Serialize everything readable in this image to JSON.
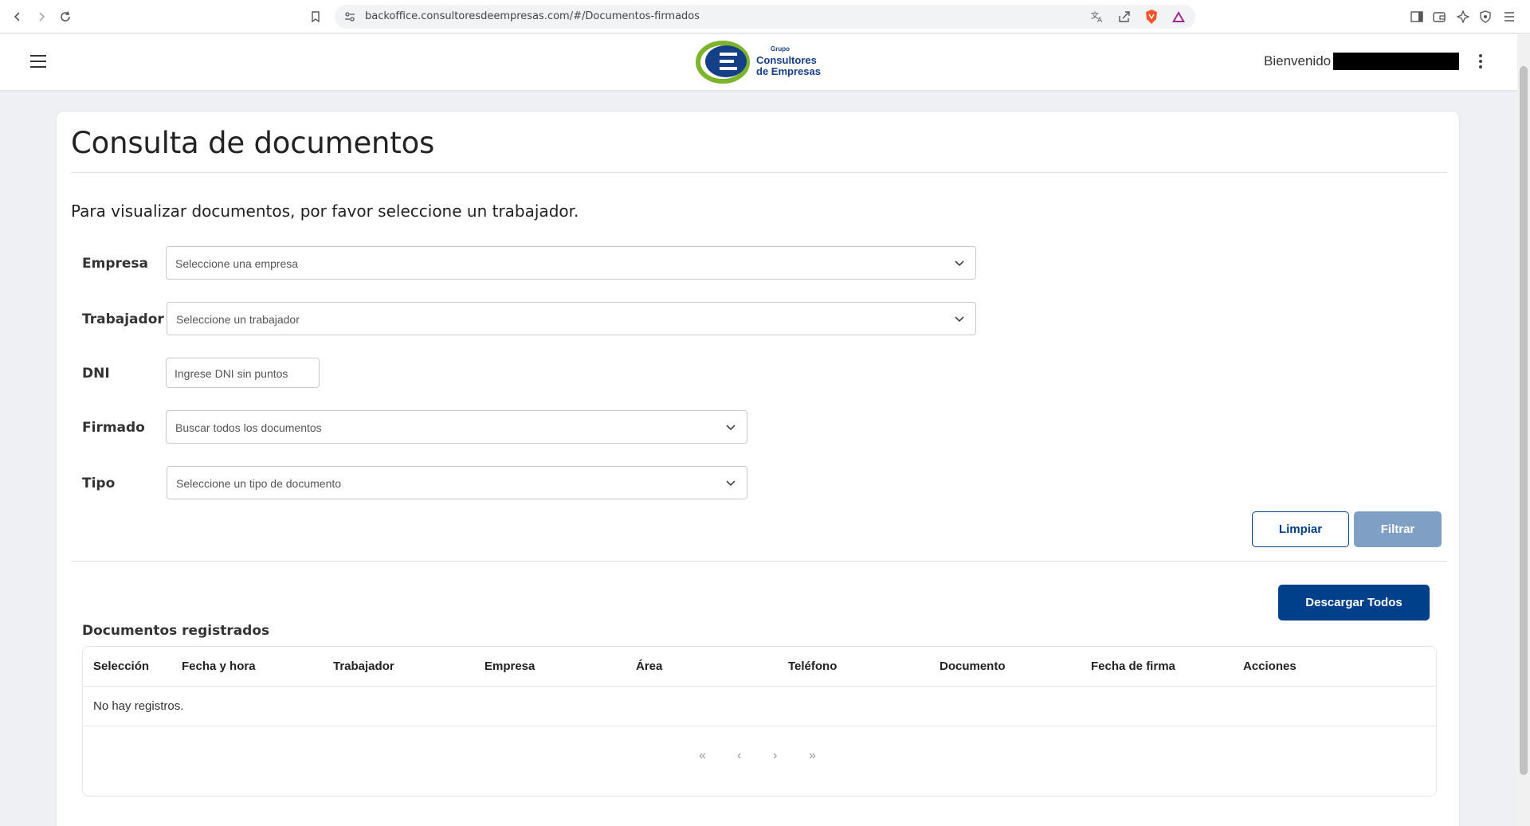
{
  "browser": {
    "url": "backoffice.consultoresdeempresas.com/#/Documentos-firmados"
  },
  "header": {
    "logo_small": "Grupo",
    "logo_line1": "Consultores",
    "logo_line2": "de Empresas",
    "welcome": "Bienvenido"
  },
  "page": {
    "title": "Consulta de documentos",
    "subtitle": "Para visualizar documentos, por favor seleccione un trabajador."
  },
  "form": {
    "empresa_label": "Empresa",
    "empresa_placeholder": "Seleccione una empresa",
    "trabajador_label": "Trabajador",
    "trabajador_placeholder": "Seleccione un trabajador",
    "dni_label": "DNI",
    "dni_placeholder": "Ingrese DNI sin puntos",
    "firmado_label": "Firmado",
    "firmado_value": "Buscar todos los documentos",
    "tipo_label": "Tipo",
    "tipo_placeholder": "Seleccione un tipo de documento",
    "limpiar": "Limpiar",
    "filtrar": "Filtrar"
  },
  "table": {
    "download_all": "Descargar Todos",
    "title": "Documentos registrados",
    "columns": [
      "Selección",
      "Fecha y hora",
      "Trabajador",
      "Empresa",
      "Área",
      "Teléfono",
      "Documento",
      "Fecha de firma",
      "Acciones"
    ],
    "empty": "No hay registros.",
    "pager": [
      "«",
      "‹",
      "›",
      "»"
    ]
  },
  "colors": {
    "primary": "#003f8a",
    "disabled": "#7f9fc4"
  }
}
